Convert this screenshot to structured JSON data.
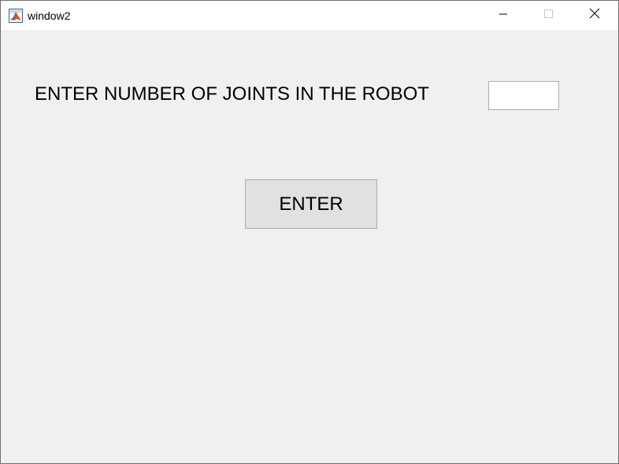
{
  "window": {
    "title": "window2",
    "app_icon": "matlab-icon",
    "controls": {
      "minimize_icon": "minimize-icon",
      "maximize_icon": "maximize-icon",
      "close_icon": "close-icon"
    }
  },
  "form": {
    "prompt_label": "ENTER NUMBER OF JOINTS IN THE ROBOT",
    "joints_input_value": "",
    "enter_button_label": "ENTER"
  },
  "colors": {
    "background": "#f0f0f0",
    "titlebar": "#ffffff",
    "button_face": "#e1e1e1",
    "border": "#adadad"
  }
}
